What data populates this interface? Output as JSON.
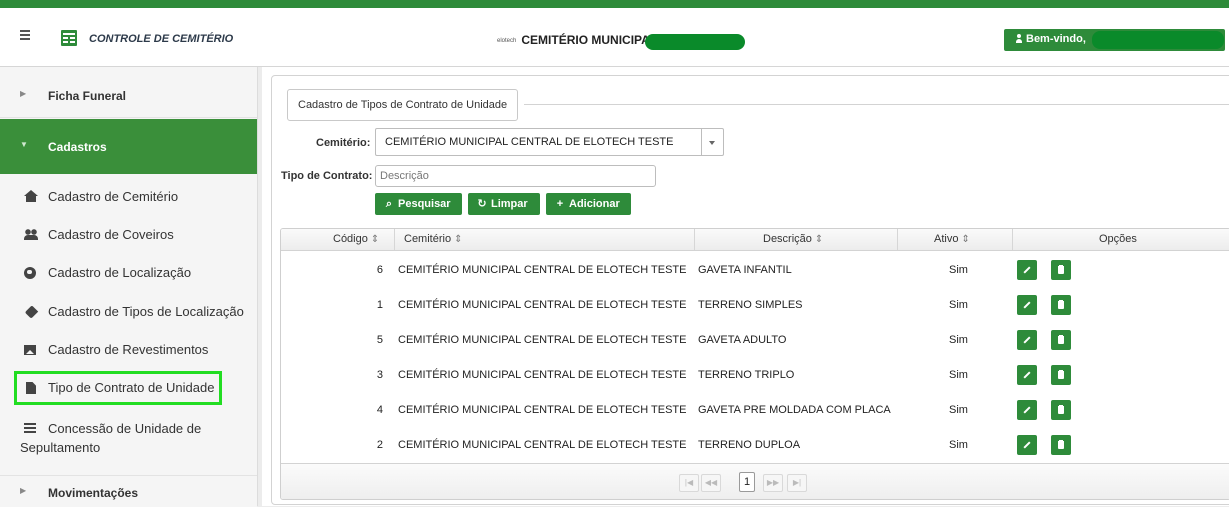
{
  "header": {
    "app_title": "CONTROLE DE CEMITÉRIO",
    "brand_small": "elotech",
    "center_title": "CEMITÉRIO MUNICIPAL",
    "welcome": "Bem-vindo,"
  },
  "sidebar": {
    "sections": {
      "ficha": "Ficha Funeral",
      "cadastros": "Cadastros",
      "movimentacoes": "Movimentações"
    },
    "items": [
      {
        "label": "Cadastro de Cemitério",
        "icon": "home-icon"
      },
      {
        "label": "Cadastro de Coveiros",
        "icon": "users-icon"
      },
      {
        "label": "Cadastro de Localização",
        "icon": "globe-icon"
      },
      {
        "label": "Cadastro de Tipos de Localização",
        "icon": "tag-icon"
      },
      {
        "label": "Cadastro de Revestimentos",
        "icon": "image-icon"
      },
      {
        "label": "Tipo de Contrato de Unidade",
        "icon": "file-icon",
        "active": true
      },
      {
        "label": "Concessão de Unidade de Sepultamento",
        "icon": "list-icon"
      }
    ]
  },
  "form": {
    "panel_title": "Cadastro de Tipos de Contrato de Unidade",
    "cemiterio_label": "Cemitério:",
    "cemiterio_value": "CEMITÉRIO MUNICIPAL CENTRAL DE ELOTECH TESTE",
    "tipo_label": "Tipo de Contrato:",
    "tipo_value": "",
    "tipo_placeholder": "Descrição",
    "buttons": {
      "search": "Pesquisar",
      "clear": "Limpar",
      "add": "Adicionar"
    }
  },
  "table": {
    "columns": [
      "Código",
      "Cemitério",
      "Descrição",
      "Ativo",
      "Opções"
    ],
    "rows": [
      {
        "codigo": "6",
        "cemiterio": "CEMITÉRIO MUNICIPAL CENTRAL DE ELOTECH TESTE",
        "descricao": "GAVETA INFANTIL",
        "ativo": "Sim"
      },
      {
        "codigo": "1",
        "cemiterio": "CEMITÉRIO MUNICIPAL CENTRAL DE ELOTECH TESTE",
        "descricao": "TERRENO SIMPLES",
        "ativo": "Sim"
      },
      {
        "codigo": "5",
        "cemiterio": "CEMITÉRIO MUNICIPAL CENTRAL DE ELOTECH TESTE",
        "descricao": "GAVETA ADULTO",
        "ativo": "Sim"
      },
      {
        "codigo": "3",
        "cemiterio": "CEMITÉRIO MUNICIPAL CENTRAL DE ELOTECH TESTE",
        "descricao": "TERRENO TRIPLO",
        "ativo": "Sim"
      },
      {
        "codigo": "4",
        "cemiterio": "CEMITÉRIO MUNICIPAL CENTRAL DE ELOTECH TESTE",
        "descricao": "GAVETA PRE MOLDADA COM PLACA",
        "ativo": "Sim"
      },
      {
        "codigo": "2",
        "cemiterio": "CEMITÉRIO MUNICIPAL CENTRAL DE ELOTECH TESTE",
        "descricao": "TERRENO DUPLOA",
        "ativo": "Sim"
      }
    ],
    "pager": {
      "current": "1"
    }
  },
  "colors": {
    "accent": "#2e8b3a",
    "highlight": "#22dd22"
  }
}
